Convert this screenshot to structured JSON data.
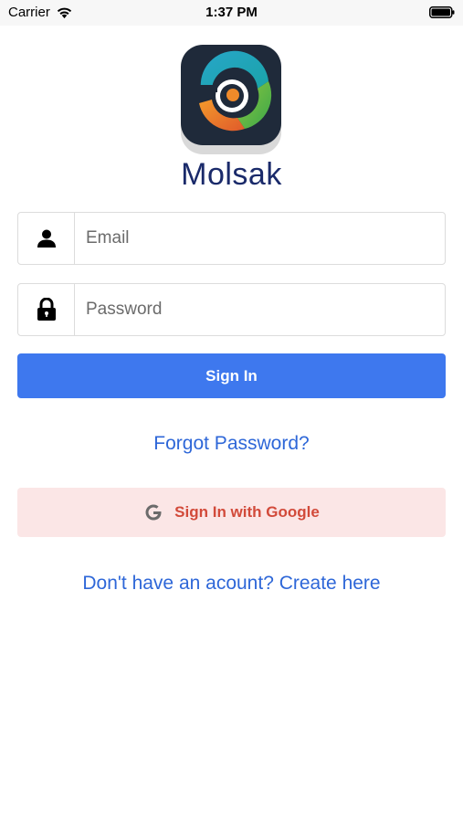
{
  "status_bar": {
    "carrier": "Carrier",
    "time": "1:37 PM",
    "wifi_icon": "wifi-icon",
    "battery_icon": "battery-icon"
  },
  "app": {
    "name": "Molsak",
    "logo_icon": "app-logo"
  },
  "login_form": {
    "email": {
      "icon": "person-icon",
      "placeholder": "Email",
      "value": ""
    },
    "password": {
      "icon": "lock-icon",
      "placeholder": "Password",
      "value": ""
    },
    "sign_in_label": "Sign In",
    "forgot_password_label": "Forgot Password?",
    "google_sign_in_label": "Sign In with Google",
    "google_icon": "google-icon",
    "create_account_label": "Don't have an acount? Create here"
  },
  "colors": {
    "primary_button": "#3e78ee",
    "link": "#2e67d8",
    "google_button_bg": "#fbe6e6",
    "google_button_text": "#d24a3a",
    "app_name": "#1a2a6a"
  }
}
